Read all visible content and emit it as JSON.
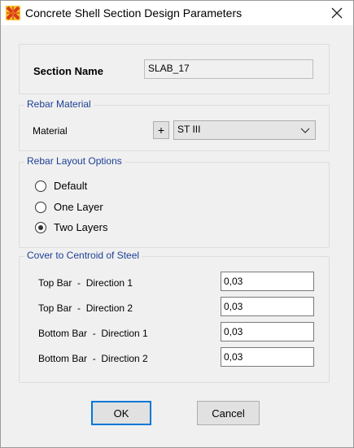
{
  "window": {
    "title": "Concrete Shell Section Design Parameters",
    "close_icon": "close-icon",
    "app_icon": "etabs-app-icon"
  },
  "section": {
    "label": "Section Name",
    "value": "SLAB_17"
  },
  "rebar_material": {
    "legend": "Rebar Material",
    "material_label": "Material",
    "add_label": "+",
    "selected": "ST III"
  },
  "rebar_layout": {
    "legend": "Rebar Layout Options",
    "options": [
      {
        "label": "Default",
        "checked": false
      },
      {
        "label": "One Layer",
        "checked": false
      },
      {
        "label": "Two Layers",
        "checked": true
      }
    ]
  },
  "cover": {
    "legend": "Cover to Centroid of Steel",
    "rows": [
      {
        "label": "Top Bar  -  Direction 1",
        "value": "0,03"
      },
      {
        "label": "Top Bar  -  Direction 2",
        "value": "0,03"
      },
      {
        "label": "Bottom Bar  -  Direction 1",
        "value": "0,03"
      },
      {
        "label": "Bottom Bar  -  Direction 2",
        "value": "0,03"
      }
    ]
  },
  "buttons": {
    "ok": "OK",
    "cancel": "Cancel"
  }
}
